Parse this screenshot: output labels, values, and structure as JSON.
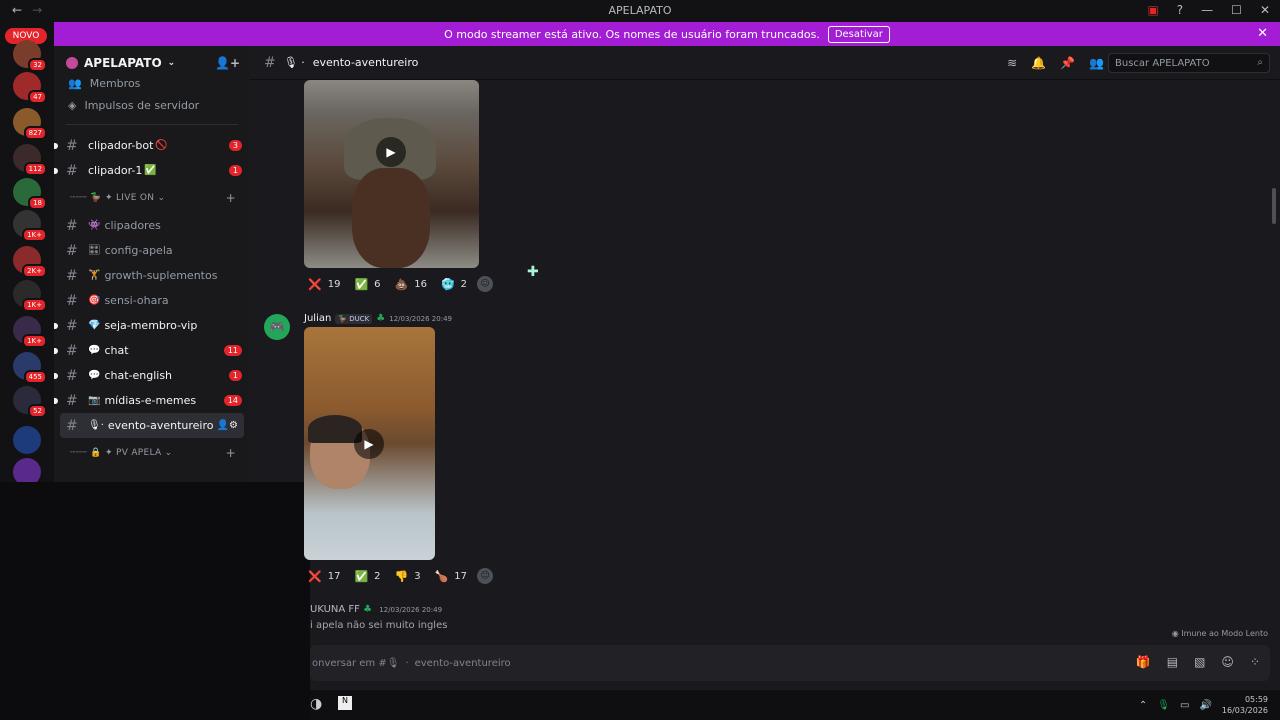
{
  "window": {
    "title": "APELAPATO"
  },
  "banner": {
    "text": "O modo streamer está ativo. Os nomes de usuário foram truncados.",
    "button": "Desativar"
  },
  "rail": {
    "novo": "NOVO",
    "servers": [
      {
        "badge": "32",
        "color": "#7a3d2b"
      },
      {
        "badge": "47",
        "color": "#a02a2a"
      },
      {
        "badge": "827",
        "color": "#8a5a2a"
      },
      {
        "badge": "112",
        "color": "#3a2a2a"
      },
      {
        "badge": "18",
        "color": "#2a6a3a"
      },
      {
        "badge": "1K+",
        "color": "#333333"
      },
      {
        "badge": "2K+",
        "color": "#8a2a2a"
      },
      {
        "badge": "1K+",
        "color": "#2a2a2a"
      },
      {
        "badge": "1K+",
        "color": "#3a2a4a"
      },
      {
        "badge": "455",
        "color": "#2a3a6a"
      },
      {
        "badge": "52",
        "color": "#2a2a3a"
      },
      {
        "badge": "",
        "color": "#1d3a7a"
      },
      {
        "badge": "",
        "color": "#5a2a8a"
      }
    ]
  },
  "sidebar": {
    "server_name": "APELAPATO",
    "menu": [
      "Membros",
      "Impulsos de servidor"
    ],
    "channels_top": [
      {
        "name": "clipador-bot",
        "emoji": "🚫",
        "badge": "3",
        "unread": true
      },
      {
        "name": "clipador-1",
        "emoji": "✅",
        "badge": "1",
        "unread": true
      }
    ],
    "category1": "✦ LIVE ON",
    "channels": [
      {
        "name": "clipadores",
        "emoji": "👾",
        "badge": "",
        "unread": false
      },
      {
        "name": "config-apela",
        "emoji": "🎛",
        "badge": "",
        "unread": false
      },
      {
        "name": "growth-suplementos",
        "emoji": "🏋",
        "badge": "",
        "unread": false
      },
      {
        "name": "sensi-ohara",
        "emoji": "🎯",
        "badge": "",
        "unread": false
      },
      {
        "name": "seja-membro-vip",
        "emoji": "💎",
        "badge": "",
        "unread": true
      },
      {
        "name": "chat",
        "emoji": "💬",
        "badge": "11",
        "unread": true
      },
      {
        "name": "chat-english",
        "emoji": "💬",
        "badge": "1",
        "unread": true
      },
      {
        "name": "mídias-e-memes",
        "emoji": "📷",
        "badge": "14",
        "unread": true
      }
    ],
    "selected_channel": "evento-aventureiro",
    "category2": "✦ PV APELA"
  },
  "header": {
    "channel": "evento-aventureiro",
    "search_placeholder": "Buscar APELAPATO"
  },
  "messages": {
    "reactions1": [
      {
        "emoji": "❌",
        "count": "19"
      },
      {
        "emoji": "✅",
        "count": "6"
      },
      {
        "emoji": "💩",
        "count": "16"
      },
      {
        "emoji": "🥶",
        "count": "2"
      }
    ],
    "author": "Julian",
    "tag": "DUCK",
    "time": "12/03/2026 20:49",
    "reactions2": [
      {
        "emoji": "❌",
        "count": "17"
      },
      {
        "emoji": "✅",
        "count": "2"
      },
      {
        "emoji": "👎",
        "count": "3"
      },
      {
        "emoji": "🍗",
        "count": "17"
      }
    ],
    "author2": "UKUNA FF",
    "time2": "12/03/2026 20:49",
    "text2": "i apela não sei muito ingles"
  },
  "status": {
    "imune": "Imune ao Modo Lento"
  },
  "composer": {
    "placeholder_prefix": "onversar em #",
    "channel": "evento-aventureiro"
  },
  "taskbar": {
    "time": "05:59",
    "date": "16/03/2026"
  }
}
